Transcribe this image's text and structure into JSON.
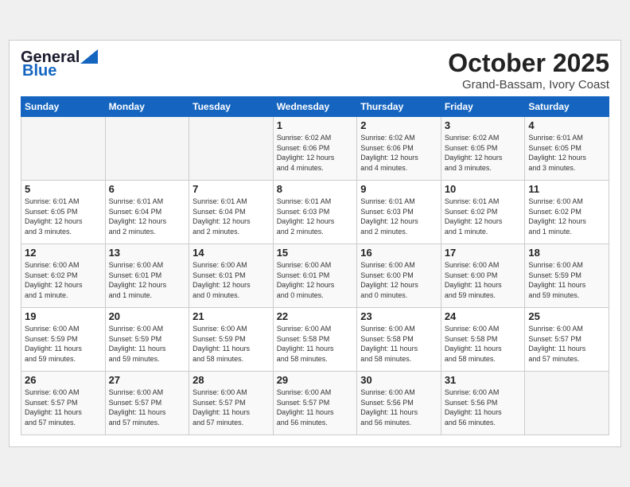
{
  "header": {
    "logo_general": "General",
    "logo_blue": "Blue",
    "month_title": "October 2025",
    "location": "Grand-Bassam, Ivory Coast"
  },
  "weekdays": [
    "Sunday",
    "Monday",
    "Tuesday",
    "Wednesday",
    "Thursday",
    "Friday",
    "Saturday"
  ],
  "weeks": [
    [
      {
        "day": "",
        "info": ""
      },
      {
        "day": "",
        "info": ""
      },
      {
        "day": "",
        "info": ""
      },
      {
        "day": "1",
        "info": "Sunrise: 6:02 AM\nSunset: 6:06 PM\nDaylight: 12 hours\nand 4 minutes."
      },
      {
        "day": "2",
        "info": "Sunrise: 6:02 AM\nSunset: 6:06 PM\nDaylight: 12 hours\nand 4 minutes."
      },
      {
        "day": "3",
        "info": "Sunrise: 6:02 AM\nSunset: 6:05 PM\nDaylight: 12 hours\nand 3 minutes."
      },
      {
        "day": "4",
        "info": "Sunrise: 6:01 AM\nSunset: 6:05 PM\nDaylight: 12 hours\nand 3 minutes."
      }
    ],
    [
      {
        "day": "5",
        "info": "Sunrise: 6:01 AM\nSunset: 6:05 PM\nDaylight: 12 hours\nand 3 minutes."
      },
      {
        "day": "6",
        "info": "Sunrise: 6:01 AM\nSunset: 6:04 PM\nDaylight: 12 hours\nand 2 minutes."
      },
      {
        "day": "7",
        "info": "Sunrise: 6:01 AM\nSunset: 6:04 PM\nDaylight: 12 hours\nand 2 minutes."
      },
      {
        "day": "8",
        "info": "Sunrise: 6:01 AM\nSunset: 6:03 PM\nDaylight: 12 hours\nand 2 minutes."
      },
      {
        "day": "9",
        "info": "Sunrise: 6:01 AM\nSunset: 6:03 PM\nDaylight: 12 hours\nand 2 minutes."
      },
      {
        "day": "10",
        "info": "Sunrise: 6:01 AM\nSunset: 6:02 PM\nDaylight: 12 hours\nand 1 minute."
      },
      {
        "day": "11",
        "info": "Sunrise: 6:00 AM\nSunset: 6:02 PM\nDaylight: 12 hours\nand 1 minute."
      }
    ],
    [
      {
        "day": "12",
        "info": "Sunrise: 6:00 AM\nSunset: 6:02 PM\nDaylight: 12 hours\nand 1 minute."
      },
      {
        "day": "13",
        "info": "Sunrise: 6:00 AM\nSunset: 6:01 PM\nDaylight: 12 hours\nand 1 minute."
      },
      {
        "day": "14",
        "info": "Sunrise: 6:00 AM\nSunset: 6:01 PM\nDaylight: 12 hours\nand 0 minutes."
      },
      {
        "day": "15",
        "info": "Sunrise: 6:00 AM\nSunset: 6:01 PM\nDaylight: 12 hours\nand 0 minutes."
      },
      {
        "day": "16",
        "info": "Sunrise: 6:00 AM\nSunset: 6:00 PM\nDaylight: 12 hours\nand 0 minutes."
      },
      {
        "day": "17",
        "info": "Sunrise: 6:00 AM\nSunset: 6:00 PM\nDaylight: 11 hours\nand 59 minutes."
      },
      {
        "day": "18",
        "info": "Sunrise: 6:00 AM\nSunset: 5:59 PM\nDaylight: 11 hours\nand 59 minutes."
      }
    ],
    [
      {
        "day": "19",
        "info": "Sunrise: 6:00 AM\nSunset: 5:59 PM\nDaylight: 11 hours\nand 59 minutes."
      },
      {
        "day": "20",
        "info": "Sunrise: 6:00 AM\nSunset: 5:59 PM\nDaylight: 11 hours\nand 59 minutes."
      },
      {
        "day": "21",
        "info": "Sunrise: 6:00 AM\nSunset: 5:59 PM\nDaylight: 11 hours\nand 58 minutes."
      },
      {
        "day": "22",
        "info": "Sunrise: 6:00 AM\nSunset: 5:58 PM\nDaylight: 11 hours\nand 58 minutes."
      },
      {
        "day": "23",
        "info": "Sunrise: 6:00 AM\nSunset: 5:58 PM\nDaylight: 11 hours\nand 58 minutes."
      },
      {
        "day": "24",
        "info": "Sunrise: 6:00 AM\nSunset: 5:58 PM\nDaylight: 11 hours\nand 58 minutes."
      },
      {
        "day": "25",
        "info": "Sunrise: 6:00 AM\nSunset: 5:57 PM\nDaylight: 11 hours\nand 57 minutes."
      }
    ],
    [
      {
        "day": "26",
        "info": "Sunrise: 6:00 AM\nSunset: 5:57 PM\nDaylight: 11 hours\nand 57 minutes."
      },
      {
        "day": "27",
        "info": "Sunrise: 6:00 AM\nSunset: 5:57 PM\nDaylight: 11 hours\nand 57 minutes."
      },
      {
        "day": "28",
        "info": "Sunrise: 6:00 AM\nSunset: 5:57 PM\nDaylight: 11 hours\nand 57 minutes."
      },
      {
        "day": "29",
        "info": "Sunrise: 6:00 AM\nSunset: 5:57 PM\nDaylight: 11 hours\nand 56 minutes."
      },
      {
        "day": "30",
        "info": "Sunrise: 6:00 AM\nSunset: 5:56 PM\nDaylight: 11 hours\nand 56 minutes."
      },
      {
        "day": "31",
        "info": "Sunrise: 6:00 AM\nSunset: 5:56 PM\nDaylight: 11 hours\nand 56 minutes."
      },
      {
        "day": "",
        "info": ""
      }
    ]
  ]
}
